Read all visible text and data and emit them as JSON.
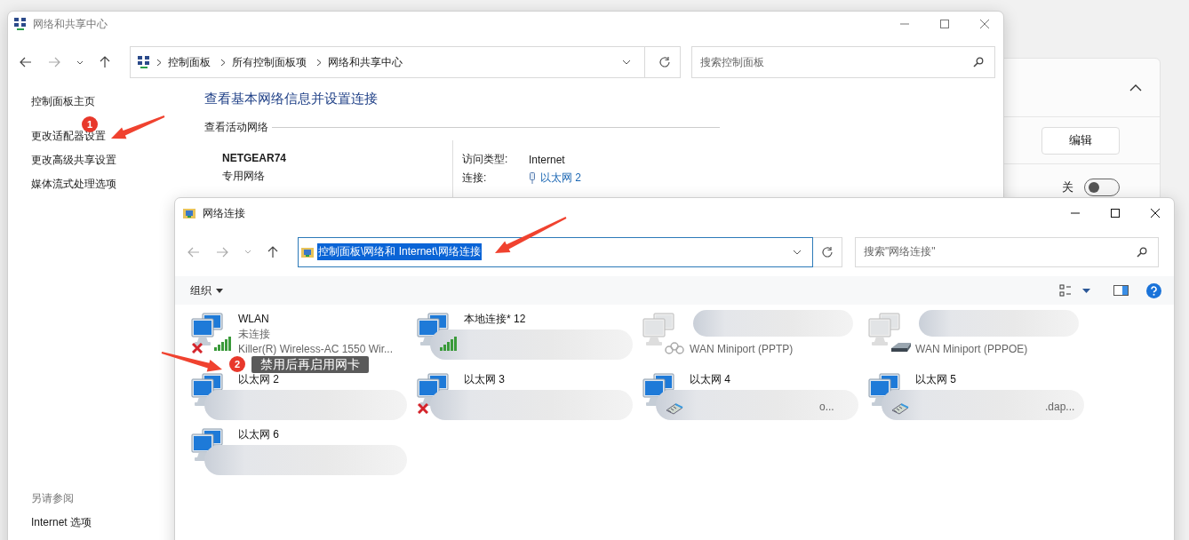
{
  "background_panel": {
    "button": "编辑",
    "toggle_label": "关",
    "toggle_on": false
  },
  "control_panel": {
    "title": "网络和共享中心",
    "breadcrumb": [
      "控制面板",
      "所有控制面板项",
      "网络和共享中心"
    ],
    "search": {
      "placeholder": "搜索控制面板"
    },
    "sidebar": {
      "items": [
        "控制面板主页",
        "更改适配器设置",
        "更改高级共享设置",
        "媒体流式处理选项"
      ],
      "see_also_heading": "另请参阅",
      "see_also": [
        "Internet 选项"
      ]
    },
    "heading": "查看基本网络信息并设置连接",
    "section": "查看活动网络",
    "network": {
      "name": "NETGEAR74",
      "type": "专用网络",
      "access_label": "访问类型:",
      "access": "Internet",
      "connection_label": "连接:",
      "connection": "以太网 2"
    }
  },
  "network_connections": {
    "title": "网络连接",
    "address": "控制面板\\网络和 Internet\\网络连接",
    "address_selected": true,
    "search": {
      "placeholder": "搜索\"网络连接\""
    },
    "organize": "组织",
    "items": [
      {
        "kind": "wifi",
        "lines": [
          "WLAN",
          "未连接",
          "Killer(R) Wireless-AC 1550 Wir..."
        ],
        "disconnected": true,
        "disabled": false,
        "name_blurred": false,
        "details_blurred": false
      },
      {
        "kind": "wifi",
        "lines": [
          "本地连接* 12"
        ],
        "disconnected": false,
        "disabled": false,
        "name_blurred": false,
        "details_blurred": true
      },
      {
        "kind": "pptp",
        "lines": [
          "WAN Miniport (PPTP)"
        ],
        "disconnected": false,
        "disabled": true,
        "name_blurred": true,
        "details_blurred": false
      },
      {
        "kind": "pppoe",
        "lines": [
          "WAN Miniport (PPPOE)"
        ],
        "disconnected": false,
        "disabled": true,
        "name_blurred": true,
        "details_blurred": false
      },
      {
        "kind": "none",
        "lines": [
          "以太网 2"
        ],
        "disconnected": false,
        "disabled": false,
        "name_blurred": false,
        "details_blurred": true
      },
      {
        "kind": "none",
        "lines": [
          "以太网 3"
        ],
        "disconnected": true,
        "disabled": false,
        "name_blurred": false,
        "details_blurred": true
      },
      {
        "kind": "ethernet",
        "lines": [
          "以太网 4"
        ],
        "tail": "o...",
        "disconnected": false,
        "disabled": false,
        "name_blurred": false,
        "details_blurred": true
      },
      {
        "kind": "ethernet",
        "lines": [
          "以太网 5"
        ],
        "tail": ".dap...",
        "disconnected": false,
        "disabled": false,
        "name_blurred": false,
        "details_blurred": true
      },
      {
        "kind": "none",
        "lines": [
          "以太网 6"
        ],
        "disconnected": false,
        "disabled": false,
        "name_blurred": false,
        "details_blurred": true
      }
    ]
  },
  "annotations": [
    {
      "kind": "step",
      "number": "1"
    },
    {
      "kind": "step",
      "number": "2"
    },
    {
      "kind": "note",
      "note": "禁用后再启用网卡"
    }
  ]
}
